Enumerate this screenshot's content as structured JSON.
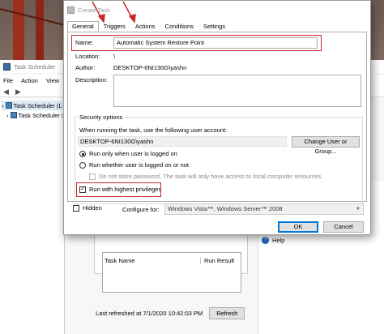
{
  "background_window": {
    "title": "Task Scheduler",
    "menu": [
      "File",
      "Action",
      "View"
    ],
    "tree": [
      "Task Scheduler (Local)",
      "Task Scheduler Library"
    ],
    "table_columns": [
      "Task Name",
      "Run Result"
    ],
    "footer_status": "Last refreshed at 7/1/2020 10:42:03 PM",
    "refresh_label": "Refresh",
    "help_label": "Help"
  },
  "dialog": {
    "title": "Create Task",
    "tabs": [
      "General",
      "Triggers",
      "Actions",
      "Conditions",
      "Settings"
    ],
    "active_tab": "General",
    "name_label": "Name:",
    "name_value": "Automatic System Restore Point",
    "location_label": "Location:",
    "location_value": "\\",
    "author_label": "Author:",
    "author_value": "DESKTOP-6NI130G\\yashn",
    "description_label": "Description:",
    "description_value": "",
    "security": {
      "title": "Security options",
      "run_as_prompt": "When running the task, use the following user account:",
      "user_account": "DESKTOP-6NI130G\\yashn",
      "change_user_button": "Change User or Group...",
      "option_logged_on": "Run only when user is logged on",
      "option_logged_on_or_not": "Run whether user is logged on or not",
      "do_not_store_password": "Do not store password.  The task will only have access to local computer resources.",
      "highest_privileges": "Run with highest privileges",
      "selected_option": "Run only when user is logged on",
      "highest_privileges_checked": true
    },
    "hidden_label": "Hidden",
    "hidden_checked": false,
    "configure_for_label": "Configure for:",
    "configure_for_value": "Windows Vista™, Windows Server™ 2008",
    "ok_label": "OK",
    "cancel_label": "Cancel"
  },
  "colors": {
    "highlight": "#c8262a",
    "wallpaper_bridge": "#9e2e1e"
  }
}
